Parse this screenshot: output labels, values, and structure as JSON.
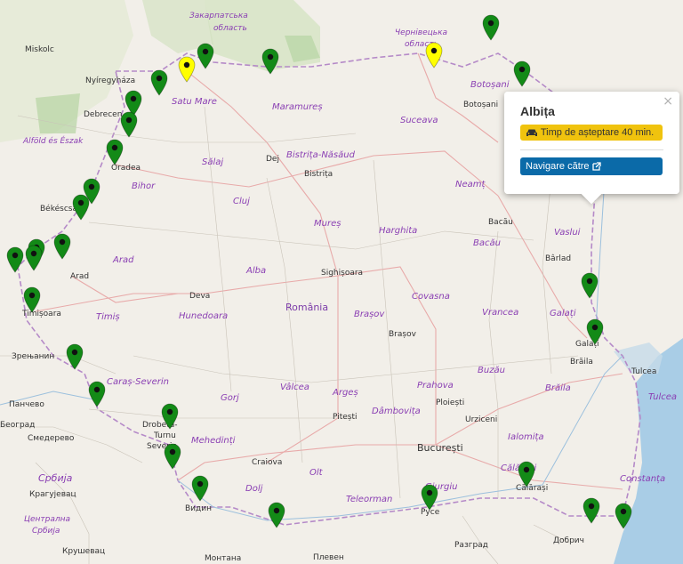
{
  "map": {
    "labels": {
      "zakarpatska": "Закарпатська",
      "oblast_z": "область",
      "chernivetska": "Чернівецька",
      "oblast_c": "область",
      "miskolc": "Miskolc",
      "nyiregyhaza": "Nyíregyháza",
      "debrecen": "Debrecen",
      "alfold": "Alföld és Észak",
      "satu_mare": "Satu Mare",
      "maramures": "Maramureș",
      "botosani_county": "Botoșani",
      "botosani_city": "Botoșani",
      "suceava": "Suceava",
      "salaj": "Sălaj",
      "dej": "Dej",
      "bistrita_nasaud": "Bistrița-Năsăud",
      "bistrita": "Bistrița",
      "neamt": "Neamț",
      "oradea": "Oradea",
      "bihor": "Bihor",
      "bekescsaba": "Békéscsaba",
      "cluj": "Cluj",
      "mures": "Mureș",
      "harghita": "Harghita",
      "bacau_city": "Bacău",
      "bacau_county": "Bacău",
      "vaslui": "Vaslui",
      "arad_county": "Arad",
      "arad_city": "Arad",
      "alba": "Alba",
      "sighisoara": "Sighișoara",
      "barlad": "Bârlad",
      "deva": "Deva",
      "timisoara": "Timișoara",
      "timis": "Timiș",
      "hunedoara": "Hunedoara",
      "romania": "România",
      "brasov_county": "Brașov",
      "covasna": "Covasna",
      "vrancea": "Vrancea",
      "galati_county": "Galați",
      "galati_city": "Galați",
      "brasov_city": "Brașov",
      "zrenjanin": "Зрењанин",
      "caras_severin": "Caraș-Severin",
      "braila_city": "Brăila",
      "tulcea_city": "Tulcea",
      "buzau": "Buzău",
      "gorj": "Gorj",
      "valcea": "Vâlcea",
      "arges": "Argeș",
      "prahova": "Prahova",
      "braila_county": "Brăila",
      "pancevo": "Панчево",
      "beograd": "Београд",
      "drobeta1": "Drobeta-",
      "drobeta2": "Turnu",
      "drobeta3": "Severin",
      "ploiesti": "Ploiești",
      "tulcea_county": "Tulcea",
      "pitesti": "Pitești",
      "dambovita": "Dâmbovița",
      "urziceni": "Urziceni",
      "smederevo": "Смедерево",
      "mehedinti": "Mehedinți",
      "ialomita": "Ialomița",
      "bucuresti": "București",
      "srbija": "Србија",
      "craiova": "Craiova",
      "olt": "Olt",
      "calarasi_county": "Călărași",
      "constanta": "Constanța",
      "dolj": "Dolj",
      "giurgiu": "Giurgiu",
      "calarasi_city": "Călărași",
      "kragujevac": "Крагујевац",
      "vidin": "Видин",
      "teleorman": "Teleorman",
      "ruse": "Русе",
      "centralna_srbija_1": "Централна",
      "centralna_srbija_2": "Србија",
      "razgrad": "Разград",
      "dobrich": "Добрич",
      "krusevac": "Крушевац",
      "montana": "Монтана",
      "pleven": "Плевен"
    },
    "marker_colors": {
      "normal": "#138a17",
      "highlight": "#ffff00"
    }
  },
  "popup": {
    "title": "Albița",
    "wait_label": "Timp de așteptare 40 min.",
    "navigate_label": "Navigare către",
    "close_label": "×",
    "wait_color": "#f0c30e",
    "navigate_color": "#0b6aa8"
  }
}
